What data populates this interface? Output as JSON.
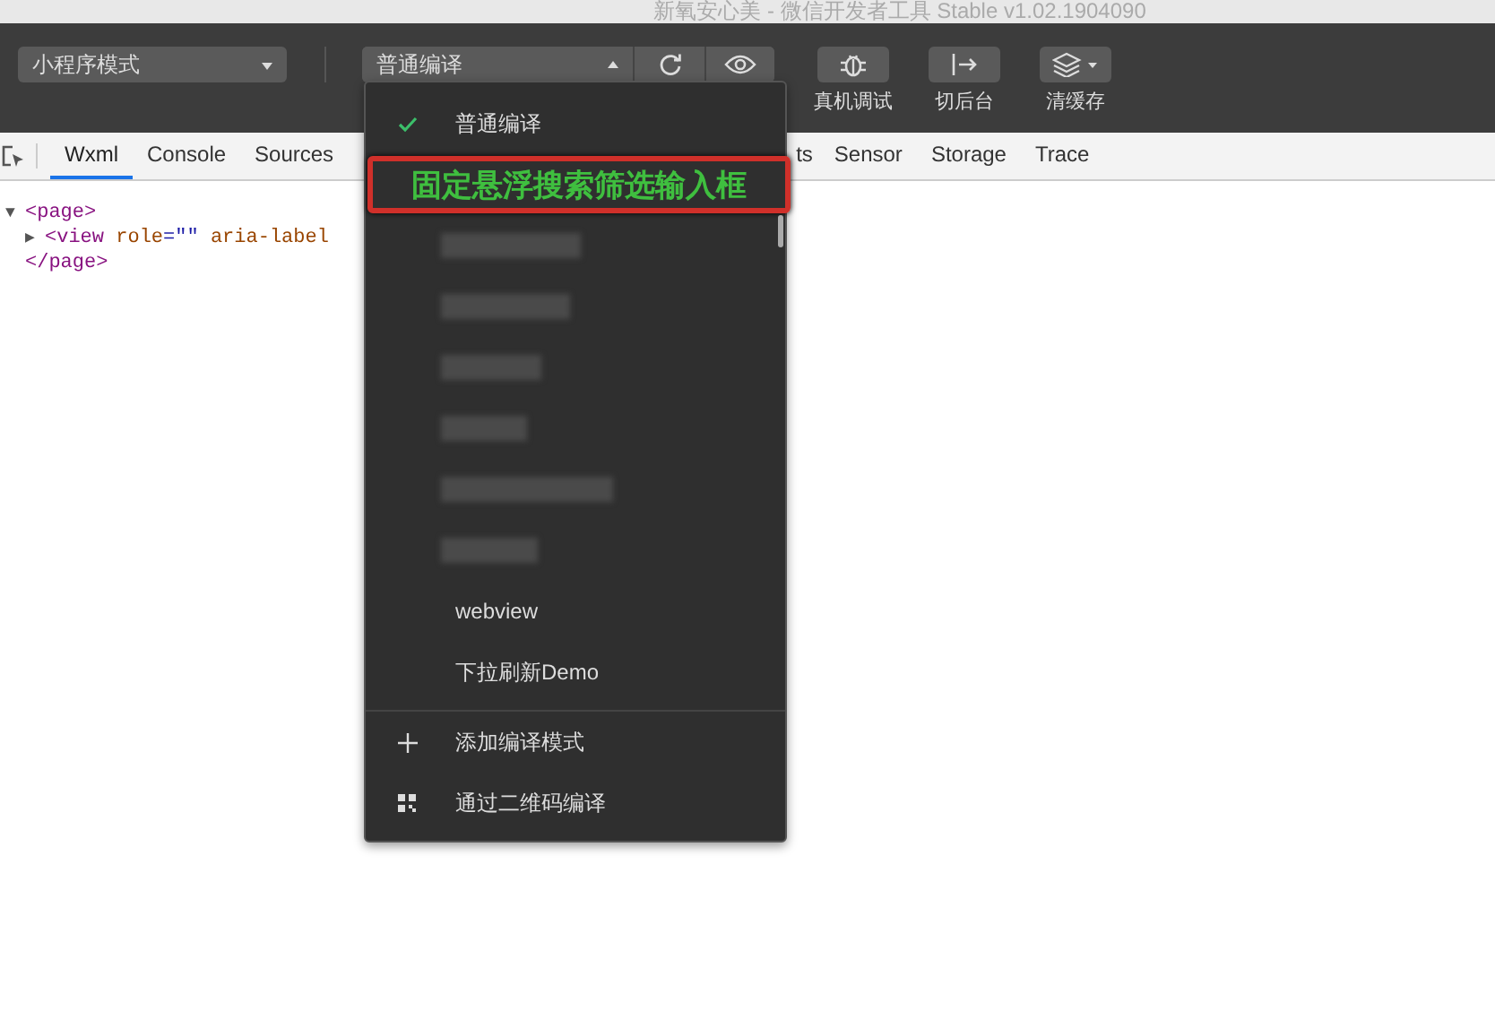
{
  "window": {
    "title": "新氧安心美 - 微信开发者工具 Stable v1.02.1904090"
  },
  "toolbar": {
    "mode_select": {
      "value": "小程序模式"
    },
    "compile_select": {
      "value": "普通编译",
      "expanded": true
    },
    "buttons": [
      {
        "kind": "bug",
        "label": "真机调试"
      },
      {
        "kind": "exit",
        "label": "切后台"
      },
      {
        "kind": "layers",
        "label": "清缓存"
      }
    ]
  },
  "tabs": [
    {
      "label": "Wxml",
      "selected": true
    },
    {
      "label": "Console",
      "selected": false
    },
    {
      "label": "Sources",
      "selected": false
    },
    {
      "label": "ts",
      "selected": false
    },
    {
      "label": "Sensor",
      "selected": false
    },
    {
      "label": "Storage",
      "selected": false
    },
    {
      "label": "Trace",
      "selected": false
    }
  ],
  "code": [
    {
      "toggle": "▼",
      "tag": "<page>",
      "children": [
        {
          "toggle": "▶",
          "tag": "<view",
          "attrs": [
            {
              "name": "role",
              "value": "=\"\""
            },
            {
              "name": "aria-label"
            }
          ]
        }
      ]
    },
    {
      "tag": "</page>"
    }
  ],
  "menu": {
    "items": [
      {
        "kind": "option",
        "label": "普通编译",
        "selected": true
      },
      {
        "kind": "redacted",
        "selected": false
      },
      {
        "kind": "redacted",
        "selected": false
      },
      {
        "kind": "redacted",
        "selected": false
      },
      {
        "kind": "redacted",
        "selected": false
      },
      {
        "kind": "redacted",
        "selected": false
      },
      {
        "kind": "redacted",
        "selected": false
      },
      {
        "kind": "option",
        "label": "webview",
        "selected": false
      },
      {
        "kind": "option",
        "label": "下拉刷新Demo",
        "selected": false
      }
    ],
    "actions": [
      {
        "kind": "add",
        "label": "添加编译模式"
      },
      {
        "kind": "qr",
        "label": "通过二维码编译"
      }
    ],
    "annotation": {
      "text": "固定悬浮搜索筛选输入框"
    }
  }
}
